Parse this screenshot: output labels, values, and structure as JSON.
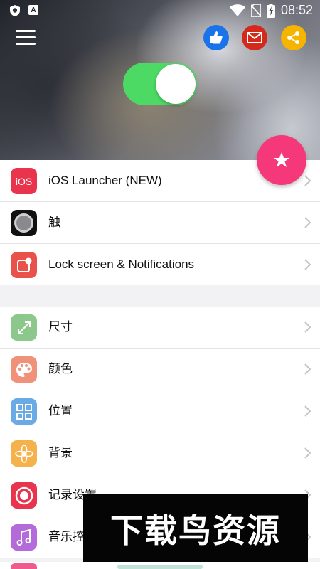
{
  "status_bar": {
    "time": "08:52",
    "left_badge_letter": "A"
  },
  "header": {
    "toggle_on": true,
    "actions": [
      {
        "name": "like-button",
        "icon": "thumbs-up-icon",
        "color": "#1a73e8"
      },
      {
        "name": "email-button",
        "icon": "mail-icon",
        "color": "#d42a1c"
      },
      {
        "name": "share-button",
        "icon": "share-icon",
        "color": "#f5b400"
      }
    ]
  },
  "settings_group_1": [
    {
      "label": "iOS Launcher (NEW)",
      "icon": "ios-icon",
      "icon_text": "iOS",
      "color": "#e8354d"
    },
    {
      "label": "触",
      "icon": "assistive-touch-icon",
      "color": "#111111"
    },
    {
      "label": "Lock screen & Notifications",
      "icon": "notification-icon",
      "color": "#e9524a"
    }
  ],
  "settings_group_2": [
    {
      "label": "尺寸",
      "icon": "resize-icon",
      "color": "#8cc88c"
    },
    {
      "label": "颜色",
      "icon": "palette-icon",
      "color": "#f0917a"
    },
    {
      "label": "位置",
      "icon": "grid-icon",
      "color": "#6aabe6"
    },
    {
      "label": "背景",
      "icon": "flower-icon",
      "color": "#f5b14c"
    },
    {
      "label": "记录设置",
      "icon": "record-icon",
      "color": "#e8354d"
    },
    {
      "label": "音乐控",
      "icon": "music-icon",
      "color": "#b46ad8"
    }
  ],
  "watermark": {
    "text": "下载鸟资源"
  },
  "colors": {
    "toggle": "#4cd964",
    "fab": "#f5387a"
  }
}
